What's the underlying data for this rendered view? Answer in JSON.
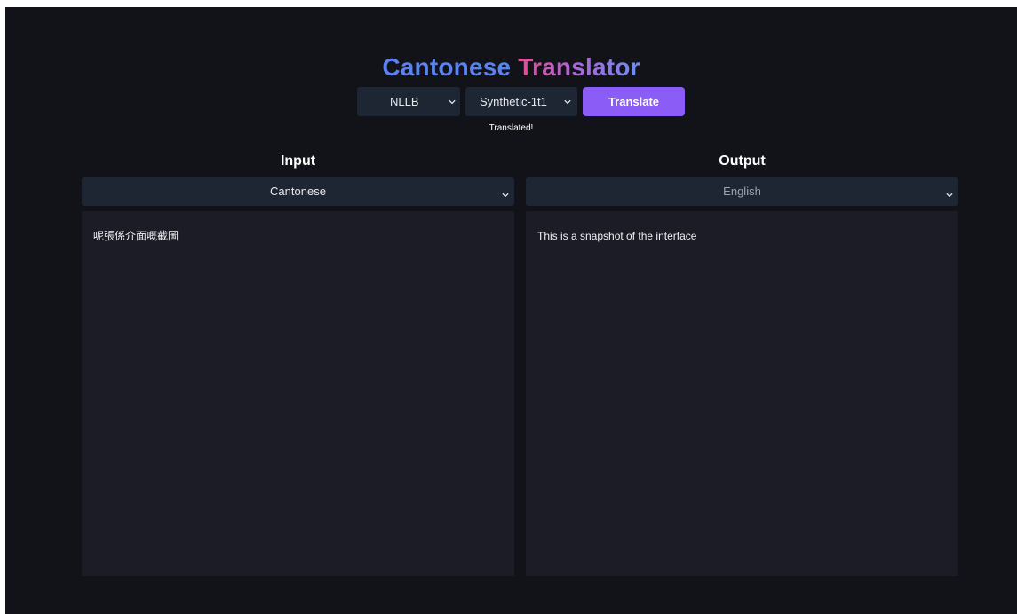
{
  "app": {
    "title_part1": "Cantonese",
    "title_part2": "Translator"
  },
  "toolbar": {
    "model_select": {
      "value": "NLLB",
      "icon": "chevron-down-icon"
    },
    "variant_select": {
      "value": "Synthetic-1t1",
      "icon": "chevron-down-icon"
    },
    "translate_label": "Translate"
  },
  "status": "Translated!",
  "input": {
    "heading": "Input",
    "language": "Cantonese",
    "text": "呢張係介面嘅截圖"
  },
  "output": {
    "heading": "Output",
    "language": "English",
    "text": "This is a snapshot of the interface"
  },
  "colors": {
    "background": "#111318",
    "control": "#1e2533",
    "textarea": "#1c1c26",
    "accent": "#8b5cf6",
    "title_blue": "#5b82f2",
    "title_pink": "#e0508f"
  }
}
